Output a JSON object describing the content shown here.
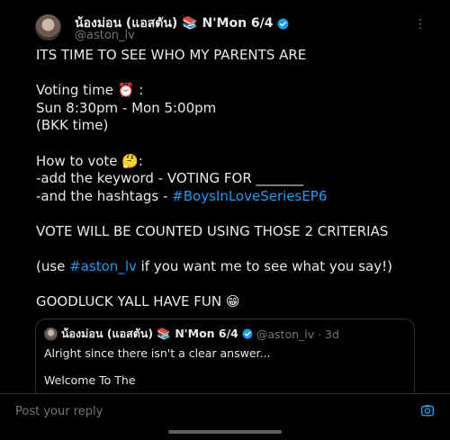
{
  "tweet": {
    "display_name": "น้องม่อน (แอสตัน) 📚 N'Mon 6/4",
    "handle": "@aston_lv",
    "more_icon": "⋮",
    "lines": [
      "ITS TIME TO SEE WHO MY PARENTS ARE",
      "",
      "Voting time ⏰ :",
      "Sun 8:30pm - Mon 5:00pm",
      "(BKK time)",
      "",
      "How to vote 🤔:",
      "-add the keyword - VOTING FOR _______",
      "-and the hashtags - ",
      "",
      "VOTE WILL BE COUNTED USING THOSE 2 CRITERIAS",
      "",
      "(use ",
      "",
      "GOODLUCK YALL HAVE FUN 😁"
    ],
    "hashtag": "#BoysInLoveSeriesEP6",
    "mention_tag": "#aston_lv",
    "use_suffix": " if you want me to see what you say!)"
  },
  "quote": {
    "display_name": "น้องม่อน (แอสตัน) 📚 N'Mon 6/4",
    "meta": "@aston_lv · 3d",
    "line1": "Alright since there isn't a clear answer...",
    "line2": "Welcome To The"
  },
  "reply": {
    "placeholder": "Post your reply"
  },
  "colors": {
    "accent": "#1d9bf0",
    "background": "#000000",
    "text": "#e7e9ea",
    "muted": "#71767b"
  }
}
